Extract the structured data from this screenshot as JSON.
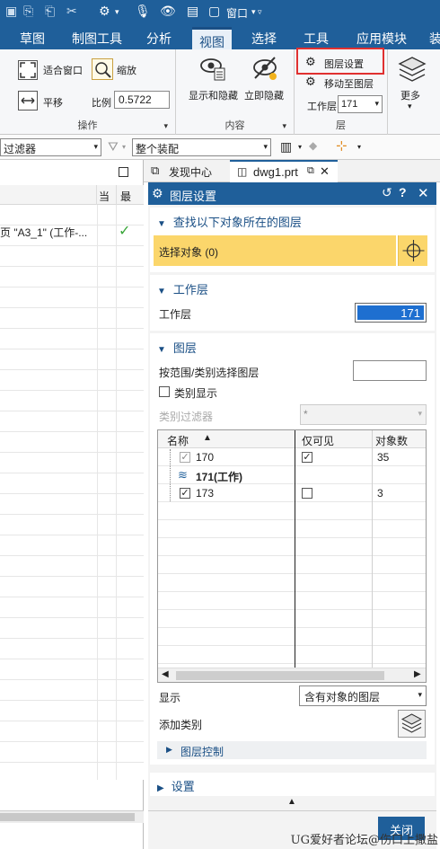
{
  "menubar": {
    "tabs": [
      "草图",
      "制图工具",
      "分析",
      "视图",
      "选择",
      "工具",
      "应用模块",
      "装"
    ],
    "active_tab": "视图"
  },
  "quickaccess": {
    "window_label": "窗口"
  },
  "ribbon": {
    "operate": {
      "fit_label": "适合窗口",
      "zoom_label": "缩放",
      "pan_label": "平移",
      "scale_label": "比例",
      "scale_value": "0.5722",
      "title": "操作"
    },
    "content": {
      "show_hide_label": "显示和隐藏",
      "instant_hide_label": "立即隐藏",
      "title": "内容"
    },
    "layer": {
      "layer_settings_label": "图层设置",
      "move_to_layer_label": "移动至图层",
      "work_layer_label": "工作层",
      "work_layer_value": "171",
      "title": "层"
    },
    "more_label": "更多"
  },
  "filterbar": {
    "filter_value": "过滤器",
    "assembly_value": "整个装配"
  },
  "leftpane": {
    "col_current": "当",
    "col_last": "最",
    "row_text": "页 \"A3_1\" (工作-...",
    "row_check": "✓"
  },
  "doctabs": {
    "discovery_label": "发现中心",
    "file_label": "dwg1.prt"
  },
  "dialog": {
    "title": "图层设置",
    "find_section": {
      "title": "查找以下对象所在的图层",
      "select_label": "选择对象 (0)"
    },
    "work_layer_section": {
      "title": "工作层",
      "label": "工作层",
      "value": "171"
    },
    "layer_section": {
      "title": "图层",
      "range_label": "按范围/类别选择图层",
      "range_value": "",
      "category_display_label": "类别显示",
      "category_filter_label": "类别过滤器",
      "category_filter_value": "*"
    },
    "table": {
      "col_name": "名称",
      "col_visible_only": "仅可见",
      "col_object_count": "对象数",
      "rows": [
        {
          "name": "170",
          "count": "35"
        },
        {
          "name": "171(工作)",
          "count": ""
        },
        {
          "name": "173",
          "count": "3"
        }
      ]
    },
    "display_label": "显示",
    "display_value": "含有对象的图层",
    "add_category_label": "添加类别",
    "layer_control_label": "图层控制",
    "settings_label": "设置",
    "close_label": "关闭"
  },
  "watermark": "UG爱好者论坛@伤口上撒盐",
  "colors": {
    "brand": "#1f5f9a",
    "highlight": "#fbd66b",
    "selection": "#1e6fd0",
    "callout": "#e03030"
  }
}
